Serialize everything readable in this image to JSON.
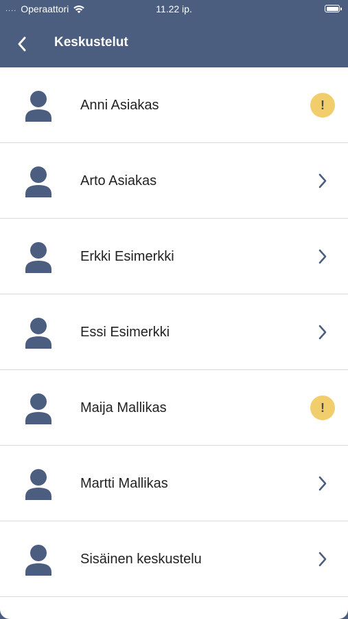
{
  "status_bar": {
    "signal": "....",
    "carrier": "Operaattori",
    "time": "11.22 ip.",
    "wifi_icon": "wifi-icon",
    "battery_icon": "battery-icon"
  },
  "nav": {
    "back_icon": "chevron-left-icon",
    "title": "Keskustelut"
  },
  "colors": {
    "header_bg": "#4b5e80",
    "avatar": "#4b5e80",
    "alert_badge": "#f2cd6b",
    "chevron": "#4b5e80",
    "divider": "#d9d9d9"
  },
  "conversations": [
    {
      "name": "Anni Asiakas",
      "indicator": "alert",
      "indicator_text": "!"
    },
    {
      "name": "Arto Asiakas",
      "indicator": "chevron"
    },
    {
      "name": "Erkki Esimerkki",
      "indicator": "chevron"
    },
    {
      "name": "Essi Esimerkki",
      "indicator": "chevron"
    },
    {
      "name": "Maija Mallikas",
      "indicator": "alert",
      "indicator_text": "!"
    },
    {
      "name": "Martti Mallikas",
      "indicator": "chevron"
    },
    {
      "name": "Sisäinen keskustelu",
      "indicator": "chevron"
    }
  ]
}
